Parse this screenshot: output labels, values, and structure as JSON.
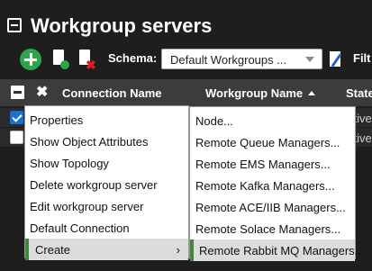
{
  "panel": {
    "title": "Workgroup servers"
  },
  "toolbar": {
    "schema_label": "Schema:",
    "schema_value": "Default Workgroups ...",
    "filter_label": "Filt"
  },
  "table": {
    "columns": [
      "Connection Name",
      "Workgroup Name",
      "State"
    ],
    "rows": [
      {
        "checked": true,
        "state": "ctive"
      },
      {
        "checked": false,
        "state": "ctive"
      }
    ]
  },
  "context_menu": {
    "items": [
      "Properties",
      "Show Object Attributes",
      "Show Topology",
      "Delete workgroup server",
      "Edit workgroup server",
      "Default Connection",
      "Create"
    ],
    "submenu_arrow": "›"
  },
  "create_submenu": {
    "items": [
      "Node...",
      "Remote Queue Managers...",
      "Remote EMS Managers...",
      "Remote Kafka Managers...",
      "Remote ACE/IIB Managers...",
      "Remote Solace Managers...",
      "Remote Rabbit MQ Managers..."
    ]
  },
  "colors": {
    "accent_green": "#3d8a3d",
    "checkbox_blue": "#1a6fd6",
    "add_green": "#2ea44f"
  }
}
